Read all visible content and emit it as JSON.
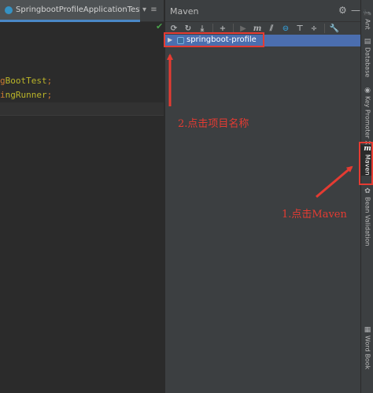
{
  "editor": {
    "tab_label": "SpringbootProfileApplicationTests.java",
    "tab_close": "×",
    "tab_overflow": "▾ ≡",
    "gutter_mark": "✔",
    "lines": [
      {
        "prefix": "g",
        "ident": "BootTest",
        "suffix": ";"
      },
      {
        "prefix": "i",
        "ident": "ngRunner",
        "suffix": ";"
      }
    ]
  },
  "maven": {
    "title": "Maven",
    "settings_icon": "⚙",
    "hide_icon": "—",
    "toolbar": [
      {
        "name": "reimport-icon",
        "glyph": "⟳"
      },
      {
        "name": "generate-sources-icon",
        "glyph": "↻"
      },
      {
        "name": "download-icon",
        "glyph": "⤓"
      },
      {
        "name": "add-maven-project-icon",
        "glyph": "+"
      },
      {
        "name": "run-icon",
        "glyph": "▶"
      },
      {
        "name": "execute-goal-icon",
        "glyph": "m"
      },
      {
        "name": "toggle-offline-icon",
        "glyph": "⫽"
      },
      {
        "name": "skip-tests-icon",
        "glyph": "⊖"
      },
      {
        "name": "show-dependencies-icon",
        "glyph": "⊤"
      },
      {
        "name": "collapse-all-icon",
        "glyph": "÷"
      },
      {
        "name": "wrench-icon",
        "glyph": "🔧"
      }
    ],
    "tree": {
      "arrow": "▶",
      "project_label": "springboot-profile"
    }
  },
  "stripe": {
    "items": [
      {
        "label": "Ant",
        "icon": "🐜"
      },
      {
        "label": "Database",
        "icon": "▤"
      },
      {
        "label": "Key Promoter X",
        "icon": "◉"
      },
      {
        "label": "Maven",
        "icon": "m"
      },
      {
        "label": "Bean Validation",
        "icon": "✿"
      },
      {
        "label": "Word Book",
        "icon": "▦"
      }
    ]
  },
  "annotations": {
    "step2": "2.点击项目名称",
    "step1": "1.点击Maven"
  },
  "colors": {
    "annotation_red": "#e53b32",
    "selection_blue": "#4b6eaf",
    "panel_bg": "#3c3f41",
    "editor_bg": "#2b2b2b"
  }
}
